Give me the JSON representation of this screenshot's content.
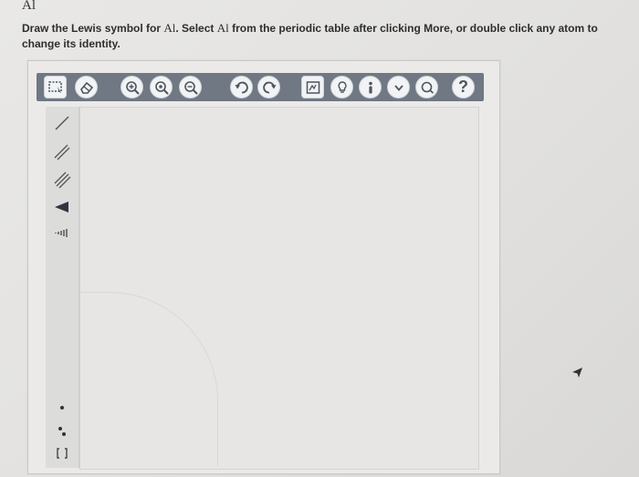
{
  "question": {
    "heading": "Al",
    "instruction_parts": [
      "Draw the Lewis symbol for ",
      "Al",
      ". Select ",
      "Al",
      " from the periodic table after clicking More, or double click any atom to change its identity."
    ]
  },
  "toolbar": {
    "buttons": [
      "select-icon",
      "eraser-icon",
      "zoom-in-icon",
      "zoom-fit-icon",
      "zoom-out-icon",
      "undo-icon",
      "redo-icon",
      "templates-icon",
      "lightbulb-icon",
      "info-icon",
      "chevron-down-icon",
      "search-icon",
      "help-icon"
    ],
    "help_label": "?"
  },
  "side_tools": [
    "single-bond-icon",
    "double-bond-icon",
    "triple-bond-icon",
    "wedge-bond-icon",
    "hash-bond-icon",
    "radical-icon",
    "lone-pair-icon",
    "brackets-icon"
  ]
}
